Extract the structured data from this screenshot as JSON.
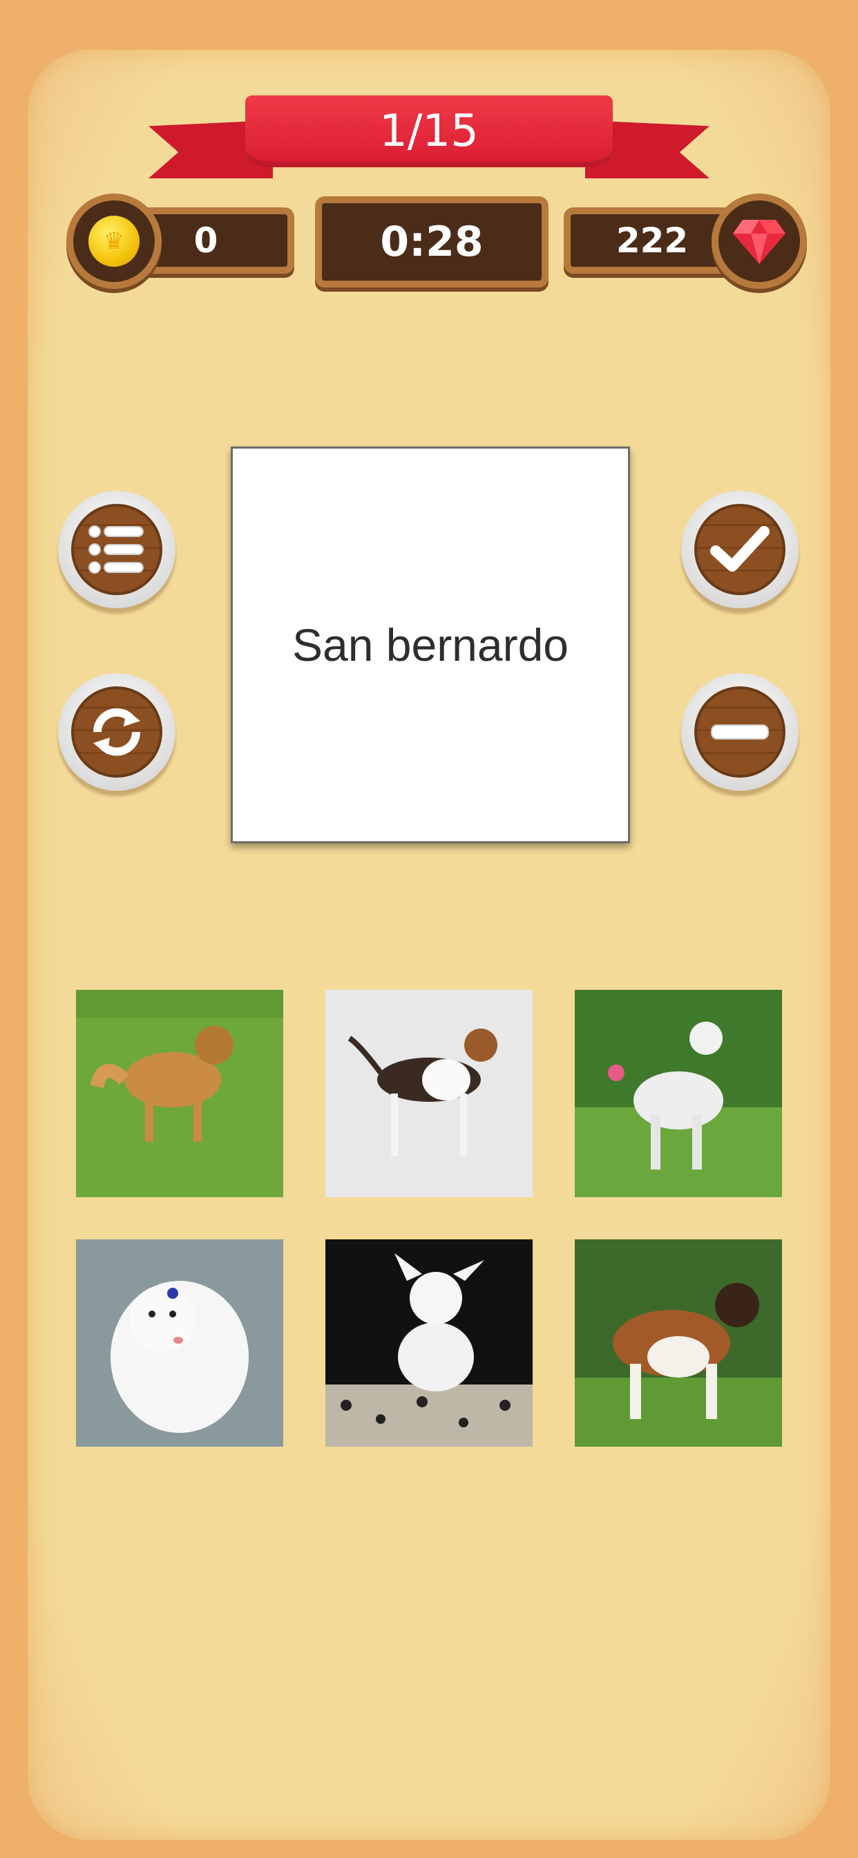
{
  "header": {
    "progress": "1/15"
  },
  "stats": {
    "coins": "0",
    "timer": "0:28",
    "gems": "222"
  },
  "card": {
    "word": "San bernardo"
  },
  "buttons": {
    "left": [
      "list-icon",
      "refresh-icon"
    ],
    "right": [
      "check-icon",
      "minus-icon"
    ]
  },
  "photos": [
    {
      "subject": "tan long-haired dog on grass"
    },
    {
      "subject": "tricolor hound dog on snow"
    },
    {
      "subject": "white curly dog in garden"
    },
    {
      "subject": "white fluffy small dog with bow"
    },
    {
      "subject": "white chihuahua on leopard cushion"
    },
    {
      "subject": "brown and white large dog on lawn"
    }
  ],
  "colors": {
    "ribbon": "#e0202f",
    "panel": "#4a2c18",
    "panel_border": "#b77a3c",
    "background": "#f4da98"
  }
}
